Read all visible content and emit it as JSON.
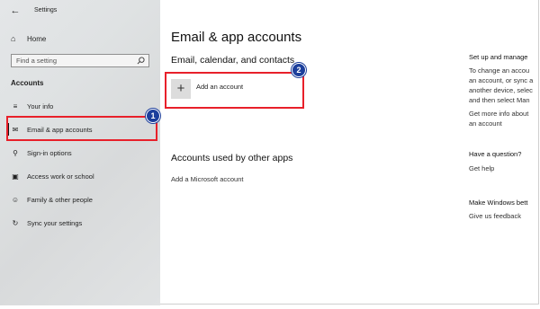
{
  "window": {
    "title": "Settings",
    "back_icon": "back-arrow-icon"
  },
  "sidebar": {
    "home_label": "Home",
    "search": {
      "placeholder": "Find a setting"
    },
    "section_label": "Accounts",
    "items": [
      {
        "label": "Your info",
        "icon": "person-card-icon"
      },
      {
        "label": "Email & app accounts",
        "icon": "mail-icon",
        "selected": true
      },
      {
        "label": "Sign-in options",
        "icon": "key-icon"
      },
      {
        "label": "Access work or school",
        "icon": "briefcase-icon"
      },
      {
        "label": "Family & other people",
        "icon": "person-add-icon"
      },
      {
        "label": "Sync your settings",
        "icon": "sync-icon"
      }
    ]
  },
  "main": {
    "title": "Email & app accounts",
    "email_section_title": "Email, calendar, and contacts",
    "add_account_label": "Add an account",
    "other_apps_title": "Accounts used by other apps",
    "add_microsoft_label": "Add a Microsoft account"
  },
  "right_panel": {
    "setup_heading": "Set up and manage",
    "setup_lines": [
      "To change an accou",
      "an account, or sync a",
      "another device, selec",
      "and then select Man"
    ],
    "more_info_lines": [
      "Get more info about",
      "an account"
    ],
    "question_heading": "Have a question?",
    "get_help": "Get help",
    "better_heading": "Make Windows bett",
    "feedback": "Give us feedback"
  },
  "annotations": {
    "badge_1": "1",
    "badge_2": "2",
    "highlight_color": "#e8202a",
    "badge_color": "#1c3f9c"
  }
}
